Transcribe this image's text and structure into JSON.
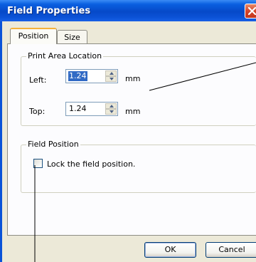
{
  "window": {
    "title": "Field Properties"
  },
  "tabs": [
    {
      "label": "Position",
      "active": true
    },
    {
      "label": "Size",
      "active": false
    }
  ],
  "print_area": {
    "legend": "Print Area Location",
    "left_label": "Left:",
    "left_value": "1.24",
    "top_label": "Top:",
    "top_value": "1.24",
    "unit": "mm"
  },
  "field_position": {
    "legend": "Field Position",
    "lock_label": "Lock the field position.",
    "lock_checked": false
  },
  "buttons": {
    "ok": "OK",
    "cancel": "Cancel"
  },
  "colors": {
    "titlebar": "#0649c8",
    "dialog_bg": "#ece9d8",
    "selection": "#316ac5"
  }
}
